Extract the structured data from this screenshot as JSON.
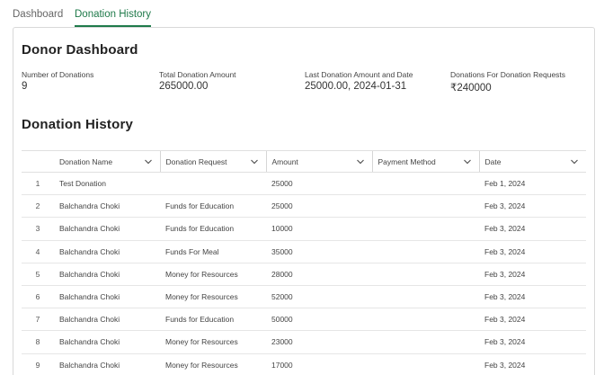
{
  "tabs": [
    {
      "label": "Dashboard",
      "active": false
    },
    {
      "label": "Donation History",
      "active": true
    }
  ],
  "dashboard": {
    "title": "Donor Dashboard",
    "stats": [
      {
        "label": "Number of Donations",
        "value": "9"
      },
      {
        "label": "Total Donation Amount",
        "value": "265000.00"
      },
      {
        "label": "Last Donation Amount and Date",
        "value": "25000.00, 2024-01-31"
      },
      {
        "label": "Donations For Donation Requests",
        "value": "₹240000"
      }
    ]
  },
  "history": {
    "title": "Donation History",
    "columns": [
      "Donation Name",
      "Donation Request",
      "Amount",
      "Payment Method",
      "Date"
    ],
    "rows": [
      {
        "n": "1",
        "name": "Test Donation",
        "request": "",
        "amount": "25000",
        "method": "",
        "date": "Feb 1, 2024"
      },
      {
        "n": "2",
        "name": "Balchandra Choki",
        "request": "Funds for Education",
        "amount": "25000",
        "method": "",
        "date": "Feb 3, 2024"
      },
      {
        "n": "3",
        "name": "Balchandra Choki",
        "request": "Funds for Education",
        "amount": "10000",
        "method": "",
        "date": "Feb 3, 2024"
      },
      {
        "n": "4",
        "name": "Balchandra Choki",
        "request": "Funds For Meal",
        "amount": "35000",
        "method": "",
        "date": "Feb 3, 2024"
      },
      {
        "n": "5",
        "name": "Balchandra Choki",
        "request": "Money for Resources",
        "amount": "28000",
        "method": "",
        "date": "Feb 3, 2024"
      },
      {
        "n": "6",
        "name": "Balchandra Choki",
        "request": "Money for Resources",
        "amount": "52000",
        "method": "",
        "date": "Feb 3, 2024"
      },
      {
        "n": "7",
        "name": "Balchandra Choki",
        "request": "Funds for Education",
        "amount": "50000",
        "method": "",
        "date": "Feb 3, 2024"
      },
      {
        "n": "8",
        "name": "Balchandra Choki",
        "request": "Money for Resources",
        "amount": "23000",
        "method": "",
        "date": "Feb 3, 2024"
      },
      {
        "n": "9",
        "name": "Balchandra Choki",
        "request": "Money for Resources",
        "amount": "17000",
        "method": "",
        "date": "Feb 3, 2024"
      }
    ]
  },
  "colors": {
    "accent": "#1f7a4a",
    "border": "#d9d9d9"
  },
  "icons": {
    "column_menu": "chevron-down-icon"
  }
}
